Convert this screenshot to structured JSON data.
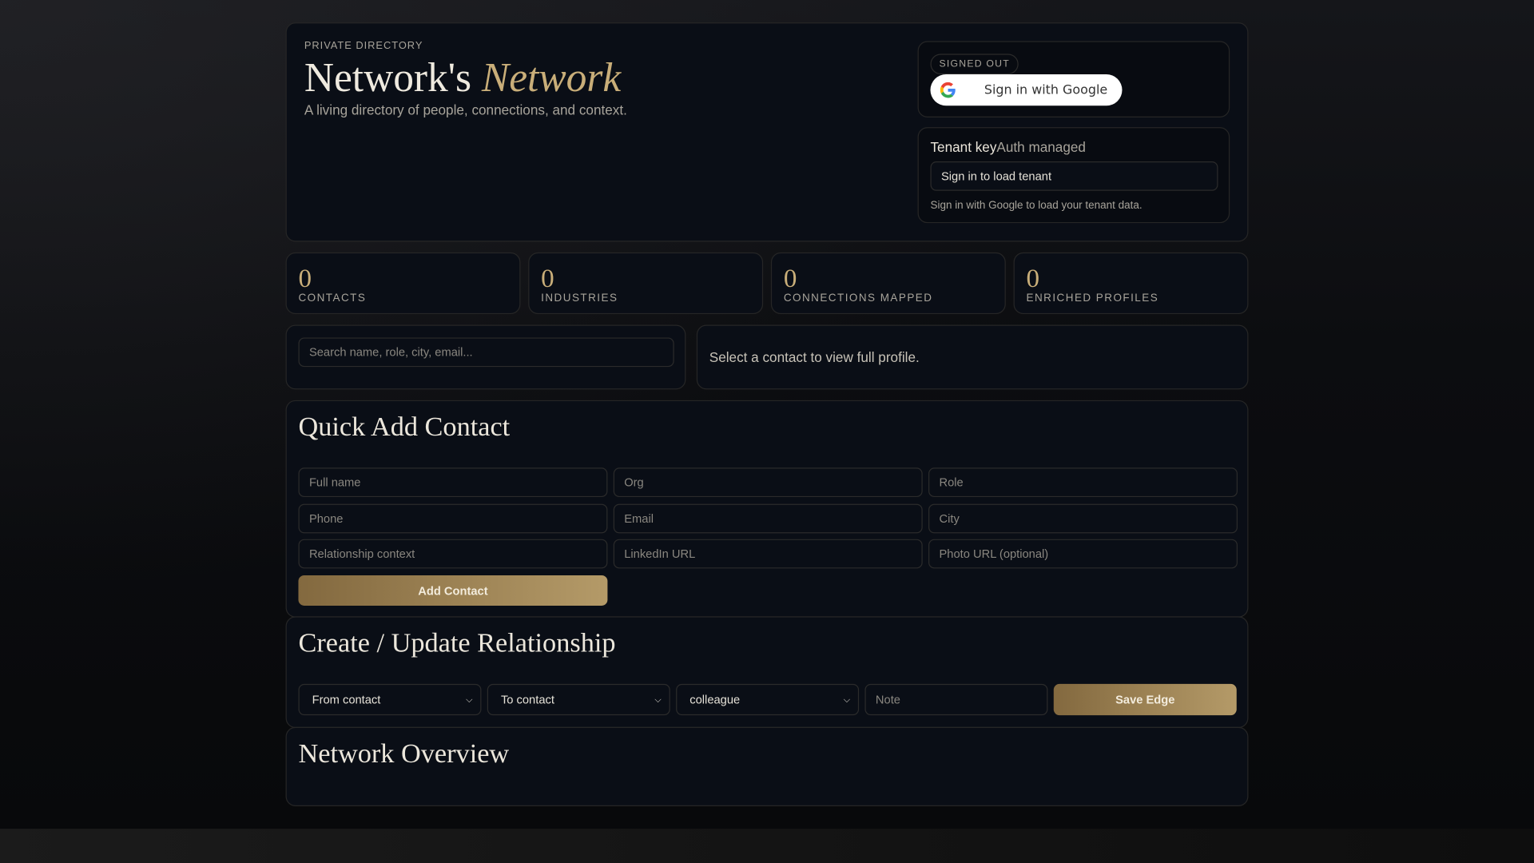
{
  "header": {
    "eyebrow": "PRIVATE DIRECTORY",
    "title_plain": "Network's ",
    "title_accent": "Network",
    "subtitle": "A living directory of people, connections, and context."
  },
  "auth": {
    "status_badge": "SIGNED OUT",
    "google_button": "Sign in with Google"
  },
  "tenant": {
    "label": "Tenant key",
    "label_note": "Auth managed",
    "field_value": "Sign in to load tenant",
    "help": "Sign in with Google to load your tenant data."
  },
  "stats": [
    {
      "value": "0",
      "label": "CONTACTS"
    },
    {
      "value": "0",
      "label": "INDUSTRIES"
    },
    {
      "value": "0",
      "label": "CONNECTIONS MAPPED"
    },
    {
      "value": "0",
      "label": "ENRICHED PROFILES"
    }
  ],
  "search": {
    "placeholder": "Search name, role, city, email..."
  },
  "profile": {
    "empty_text": "Select a contact to view full profile."
  },
  "quick_add": {
    "title": "Quick Add Contact",
    "fields": [
      "Full name",
      "Org",
      "Role",
      "Phone",
      "Email",
      "City",
      "Relationship context",
      "LinkedIn URL",
      "Photo URL (optional)"
    ],
    "submit": "Add Contact"
  },
  "relationship": {
    "title": "Create / Update Relationship",
    "from": "From contact",
    "to": "To contact",
    "type": "colleague",
    "note_placeholder": "Note",
    "submit": "Save Edge"
  },
  "overview": {
    "title": "Network Overview"
  },
  "colors": {
    "accent": "#c9ae79",
    "background": "#0a0e16"
  }
}
